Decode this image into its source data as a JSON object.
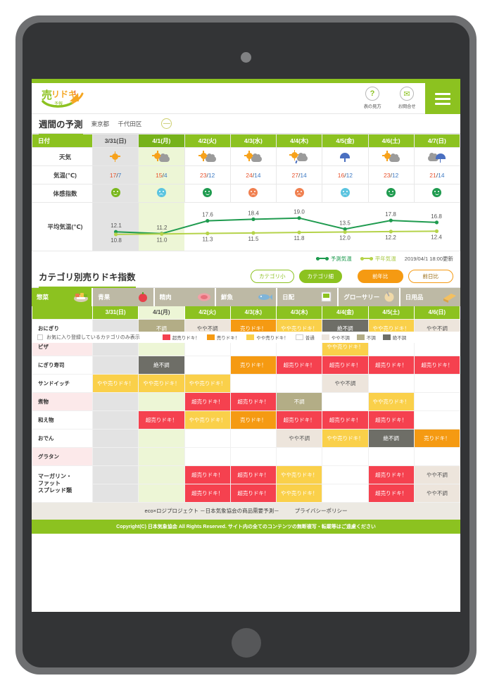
{
  "header": {
    "logo_alt": "売りドキ！予報",
    "icons": [
      {
        "name": "help-icon",
        "glyph": "?",
        "label": "表の見方"
      },
      {
        "name": "mail-icon",
        "glyph": "✉",
        "label": "お問合せ"
      }
    ]
  },
  "weather_section": {
    "title": "週間の予測",
    "region1": "東京都",
    "region2": "千代田区",
    "collapse": "—",
    "row_labels": {
      "date": "日付",
      "weather": "天気",
      "temp": "気温(℃)",
      "comfort": "体感指数",
      "avgtemp": "平均気温(℃)"
    },
    "dates": [
      "3/31(日)",
      "4/1(月)",
      "4/2(火)",
      "4/3(水)",
      "4/4(木)",
      "4/5(金)",
      "4/6(土)",
      "4/7(日)"
    ],
    "weather_icons": [
      "sunny",
      "sunny-cloudy",
      "sunny-cloudy",
      "sunny-cloudy",
      "sunny-cloudy-rain",
      "rain",
      "sunny-cloudy",
      "cloudy-rain"
    ],
    "temps_high": [
      "17",
      "15",
      "23",
      "24",
      "27",
      "16",
      "23",
      "21"
    ],
    "temps_low": [
      "7",
      "4",
      "12",
      "14",
      "14",
      "12",
      "12",
      "14"
    ],
    "comfort": [
      "green-light",
      "blue",
      "green",
      "orange",
      "orange",
      "blue",
      "green",
      "green"
    ],
    "legend_forecast": "予測気温",
    "legend_average": "平年気温",
    "updated": "2019/04/1 18:00更新"
  },
  "chart_data": {
    "type": "line",
    "title": "平均気温(℃)",
    "categories": [
      "3/31(日)",
      "4/1(月)",
      "4/2(火)",
      "4/3(水)",
      "4/4(木)",
      "4/5(金)",
      "4/6(土)",
      "4/7(日)"
    ],
    "series": [
      {
        "name": "予測気温",
        "color": "#1f9b4f",
        "values": [
          12.1,
          11.2,
          17.6,
          18.4,
          19.0,
          13.5,
          17.8,
          16.8
        ]
      },
      {
        "name": "平年気温",
        "color": "#b5d34a",
        "values": [
          10.8,
          11.0,
          11.3,
          11.5,
          11.8,
          12.0,
          12.2,
          12.4
        ]
      }
    ],
    "ylim": [
      9.0,
      21.0
    ],
    "grid": false,
    "legend_position": "bottom-right",
    "xlabel": "",
    "ylabel": "平均気温(℃)"
  },
  "category_section": {
    "title": "カテゴリ別売りドキ指数",
    "buttons": [
      {
        "name": "category-small-button",
        "label": "カテゴリ小",
        "style": "outline-g"
      },
      {
        "name": "category-fine-button",
        "label": "カテゴリ細",
        "style": "fill-g"
      },
      {
        "name": "yoy-button",
        "label": "前年比",
        "style": "fill-o"
      },
      {
        "name": "dod-button",
        "label": "前日比",
        "style": "outline-o"
      }
    ],
    "tabs": [
      {
        "label": "惣菜",
        "icon": "deli-icon",
        "active": true
      },
      {
        "label": "青果",
        "icon": "produce-icon",
        "active": false
      },
      {
        "label": "精肉",
        "icon": "meat-icon",
        "active": false
      },
      {
        "label": "鮮魚",
        "icon": "fish-icon",
        "active": false
      },
      {
        "label": "日配",
        "icon": "daily-icon",
        "active": false
      },
      {
        "label": "グローサリー",
        "icon": "grocery-icon",
        "active": false
      },
      {
        "label": "日用品",
        "icon": "household-icon",
        "active": false
      }
    ],
    "dates": [
      "3/31(日)",
      "4/1(月)",
      "4/2(火)",
      "4/3(水)",
      "4/3(木)",
      "4/4(金)",
      "4/5(土)",
      "4/6(日)"
    ],
    "selected_date_index": 1,
    "favorite_filter_label": "お気に入り登録しているカテゴリのみ表示",
    "legend": [
      {
        "label": "超売りドキ！",
        "color": "#f5414f"
      },
      {
        "label": "売りドキ！",
        "color": "#f59a12"
      },
      {
        "label": "やや売りドキ！",
        "color": "#fad04a"
      },
      {
        "label": "普通",
        "color": "#ffffff"
      },
      {
        "label": "やや不調",
        "color": "#ede5dc"
      },
      {
        "label": "不調",
        "color": "#b3ad86"
      },
      {
        "label": "絶不調",
        "color": "#6e6e67"
      }
    ],
    "rows": [
      {
        "name": "おにぎり",
        "alt": false,
        "cells": [
          "",
          "不調",
          "やや不調",
          "売りドキ！",
          "やや売りドキ！",
          "絶不調",
          "やや売りドキ！",
          "やや不調"
        ]
      },
      {
        "name": "ピザ",
        "alt": true,
        "cells": [
          "",
          "",
          "",
          "",
          "",
          "やや売りドキ！",
          "",
          ""
        ]
      },
      {
        "name": "にぎり寿司",
        "alt": false,
        "cells": [
          "",
          "絶不調",
          "",
          "売りドキ！",
          "超売りドキ！",
          "超売りドキ！",
          "超売りドキ！",
          "超売りドキ！"
        ]
      },
      {
        "name": "サンドイッチ",
        "alt": false,
        "cells": [
          "やや売りドキ！",
          "やや売りドキ！",
          "やや売りドキ！",
          "",
          "",
          "やや不調",
          "",
          ""
        ]
      },
      {
        "name": "煮物",
        "alt": true,
        "cells": [
          "",
          "",
          "超売りドキ！",
          "超売りドキ！",
          "不調",
          "",
          "やや売りドキ！",
          ""
        ]
      },
      {
        "name": "和え物",
        "alt": false,
        "cells": [
          "",
          "超売りドキ！",
          "やや売りドキ！",
          "売りドキ！",
          "超売りドキ！",
          "超売りドキ！",
          "超売りドキ！",
          ""
        ]
      },
      {
        "name": "おでん",
        "alt": false,
        "cells": [
          "",
          "",
          "",
          "",
          "やや不調",
          "やや売りドキ！",
          "絶不調",
          "売りドキ！"
        ]
      },
      {
        "name": "グラタン",
        "alt": true,
        "cells": [
          "",
          "",
          "",
          "",
          "",
          "",
          "",
          ""
        ]
      },
      {
        "name": "マーガリン・\nファット\nスプレッド類",
        "alt": false,
        "tall": true,
        "cells": [
          "",
          "",
          "超売りドキ！",
          "超売りドキ！",
          "やや売りドキ！",
          "",
          "超売りドキ！",
          "やや不調"
        ],
        "cells2": [
          "",
          "",
          "超売りドキ！",
          "超売りドキ！",
          "やや売りドキ！",
          "",
          "超売りドキ！",
          "やや不調"
        ]
      }
    ]
  },
  "footer": {
    "links": [
      "eco×ロジプロジェクト －日本気象協会の商品需要予測－",
      "プライバシーポリシー"
    ],
    "copyright": "Copyright(C) 日本気象協会 All Rights Reserved.  サイト内の全てのコンテンツの無断複写・転載等はご遠慮ください"
  }
}
